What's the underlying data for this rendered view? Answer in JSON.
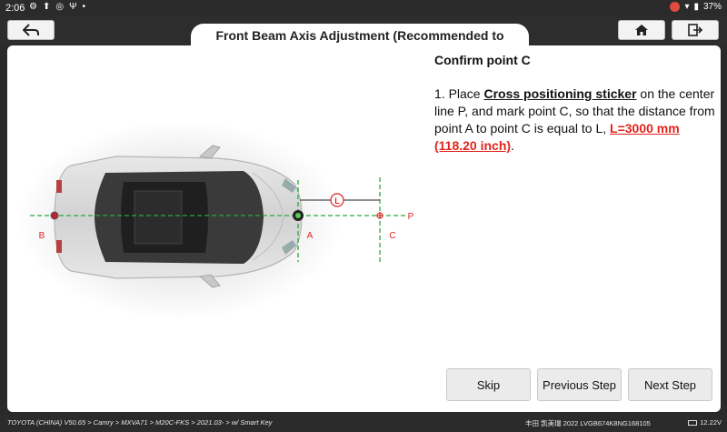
{
  "status_bar": {
    "time": "2:06",
    "battery": "37%"
  },
  "header": {
    "title": "Front Beam Axis Adjustment (Recommended to perform)"
  },
  "diagram": {
    "label_b": "B",
    "label_a": "A",
    "label_c": "C",
    "label_p": "P",
    "label_l": "L"
  },
  "instructions": {
    "title": "Confirm point C",
    "step_prefix": "1. Place ",
    "sticker_name": "Cross positioning sticker",
    "step_middle": " on the center line P, and mark point C, so that the distance from point A to point C is equal to L, ",
    "distance": "L=3000 mm (118.20 inch)",
    "step_suffix": "."
  },
  "buttons": {
    "skip": "Skip",
    "previous": "Previous Step",
    "next": "Next Step"
  },
  "footer": {
    "breadcrumb": "TOYOTA (CHINA) V50.65 > Camry > MXVA71 > M20C-FKS > 2021.03- > w/ Smart Key",
    "vehicle": "丰田 凯美瑞 2022  LVGB674K8NG168105",
    "voltage": "12.22V"
  }
}
